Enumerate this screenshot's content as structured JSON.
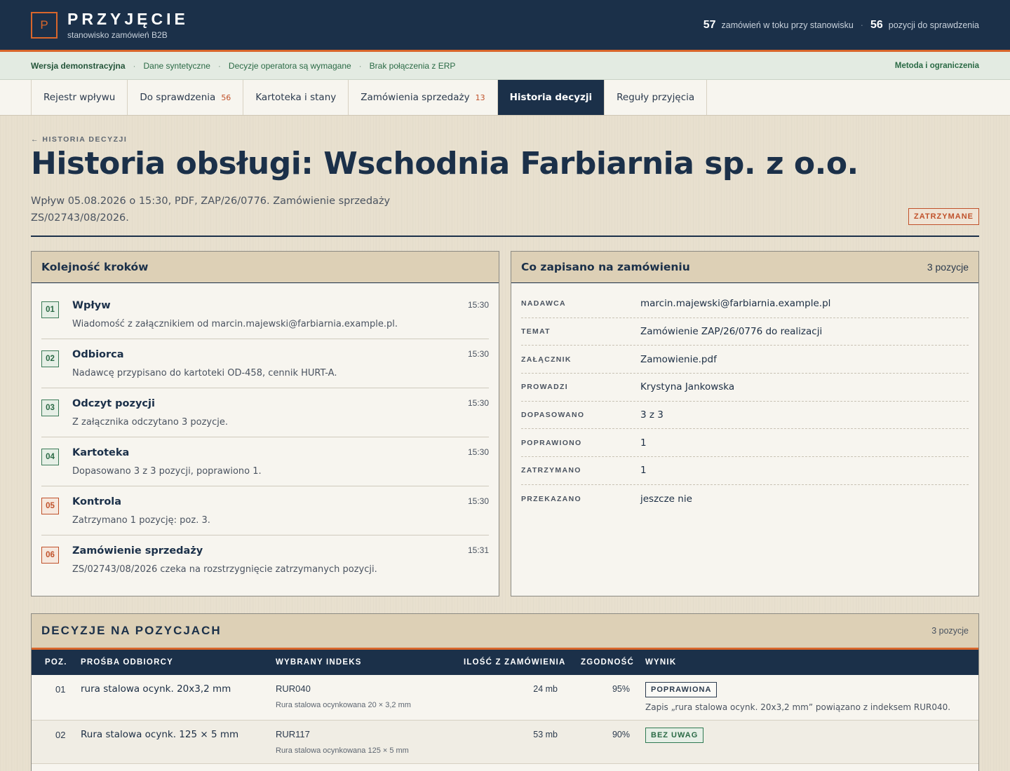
{
  "header": {
    "logo_letter": "P",
    "app_name": "PRZYJĘCIE",
    "app_sub": "stanowisko zamówień B2B",
    "stat1_num": "57",
    "stat1_label": "zamówień w toku przy stanowisku",
    "stat2_num": "56",
    "stat2_label": "pozycji do sprawdzenia"
  },
  "notice": {
    "items": [
      "Wersja demonstracyjna",
      "Dane syntetyczne",
      "Decyzje operatora są wymagane",
      "Brak połączenia z ERP"
    ],
    "link": "Metoda i ograniczenia"
  },
  "tabs": [
    {
      "label": "Rejestr wpływu",
      "count": ""
    },
    {
      "label": "Do sprawdzenia",
      "count": "56"
    },
    {
      "label": "Kartoteka i stany",
      "count": ""
    },
    {
      "label": "Zamówienia sprzedaży",
      "count": "13"
    },
    {
      "label": "Historia decyzji",
      "count": ""
    },
    {
      "label": "Reguły przyjęcia",
      "count": ""
    }
  ],
  "page": {
    "back": "← HISTORIA DECYZJI",
    "title": "Historia obsługi: Wschodnia Farbiarnia sp. z o.o.",
    "subtitle": "Wpływ 05.08.2026 o 15:30, PDF, ZAP/26/0776. Zamówienie sprzedaży ZS/02743/08/2026.",
    "status": "ZATRZYMANE"
  },
  "steps_panel": {
    "title": "Kolejność kroków",
    "steps": [
      {
        "num": "01",
        "title": "Wpływ",
        "desc": "Wiadomość z załącznikiem od marcin.majewski@farbiarnia.example.pl.",
        "time": "15:30"
      },
      {
        "num": "02",
        "title": "Odbiorca",
        "desc": "Nadawcę przypisano do kartoteki OD-458, cennik HURT-A.",
        "time": "15:30"
      },
      {
        "num": "03",
        "title": "Odczyt pozycji",
        "desc": "Z załącznika odczytano 3 pozycje.",
        "time": "15:30"
      },
      {
        "num": "04",
        "title": "Kartoteka",
        "desc": "Dopasowano 3 z 3 pozycji, poprawiono 1.",
        "time": "15:30"
      },
      {
        "num": "05",
        "title": "Kontrola",
        "desc": "Zatrzymano 1 pozycję: poz. 3.",
        "time": "15:30"
      },
      {
        "num": "06",
        "title": "Zamówienie sprzedaży",
        "desc": "ZS/02743/08/2026 czeka na rozstrzygnięcie zatrzymanych pozycji.",
        "time": "15:31"
      }
    ]
  },
  "order_panel": {
    "title": "Co zapisano na zamówieniu",
    "count": "3 pozycje",
    "rows": [
      {
        "key": "NADAWCA",
        "value": "marcin.majewski@farbiarnia.example.pl"
      },
      {
        "key": "TEMAT",
        "value": "Zamówienie ZAP/26/0776 do realizacji"
      },
      {
        "key": "ZAŁĄCZNIK",
        "value": "Zamowienie.pdf"
      },
      {
        "key": "PROWADZI",
        "value": "Krystyna Jankowska"
      },
      {
        "key": "DOPASOWANO",
        "value": "3 z 3"
      },
      {
        "key": "POPRAWIONO",
        "value": "1"
      },
      {
        "key": "ZATRZYMANO",
        "value": "1"
      },
      {
        "key": "PRZEKAZANO",
        "value": "jeszcze nie"
      }
    ]
  },
  "decisions": {
    "title": "DECYZJE NA POZYCJACH",
    "count": "3 pozycje",
    "columns": [
      "POZ.",
      "PROŚBA ODBIORCY",
      "WYBRANY INDEKS",
      "ILOŚĆ Z ZAMÓWIENIA",
      "ZGODNOŚĆ",
      "WYNIK"
    ],
    "rows": [
      {
        "pos": "01",
        "request": "rura stalowa ocynk. 20x3,2 mm",
        "index": "RUR040",
        "index_desc": "Rura stalowa ocynkowana 20 × 3,2 mm",
        "qty": "24 mb",
        "match": "95%",
        "result": "POPRAWIONA",
        "note": "Zapis „rura stalowa ocynk. 20x3,2 mm” powiązano z indeksem RUR040."
      },
      {
        "pos": "02",
        "request": "Rura stalowa ocynk. 125 × 5 mm",
        "index": "RUR117",
        "index_desc": "Rura stalowa ocynkowana 125 × 5 mm",
        "qty": "53 mb",
        "match": "90%",
        "result": "BEZ UWAG",
        "note": ""
      }
    ]
  }
}
